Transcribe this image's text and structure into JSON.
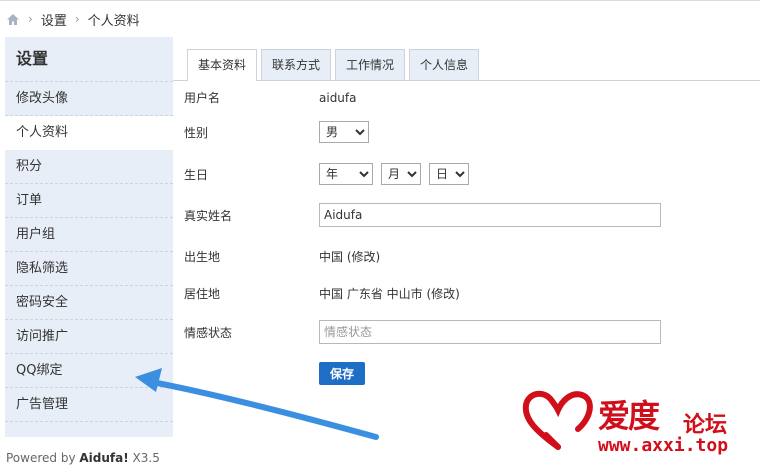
{
  "breadcrumb": {
    "home_icon": "home-icon",
    "sep": "›",
    "items": [
      "设置",
      "个人资料"
    ]
  },
  "sidebar": {
    "title": "设置",
    "items": [
      {
        "label": "修改头像"
      },
      {
        "label": "个人资料",
        "active": true
      },
      {
        "label": "积分"
      },
      {
        "label": "订单"
      },
      {
        "label": "用户组"
      },
      {
        "label": "隐私筛选"
      },
      {
        "label": "密码安全"
      },
      {
        "label": "访问推广"
      },
      {
        "label": "QQ绑定"
      },
      {
        "label": "广告管理"
      }
    ]
  },
  "tabs": [
    "基本资料",
    "联系方式",
    "工作情况",
    "个人信息"
  ],
  "form": {
    "username_label": "用户名",
    "username_value": "aidufa",
    "gender_label": "性别",
    "gender_value": "男",
    "birthday_label": "生日",
    "year_value": "年",
    "month_value": "月",
    "day_value": "日",
    "realname_label": "真实姓名",
    "realname_value": "Aidufa",
    "birthplace_label": "出生地",
    "birthplace_value": "中国 (修改)",
    "residence_label": "居住地",
    "residence_value": "中国 广东省 中山市 (修改)",
    "relationship_label": "情感状态",
    "relationship_placeholder": "情感状态",
    "save_label": "保存"
  },
  "footer": {
    "prefix": "Powered by ",
    "brand": "Aidufa!",
    "version": " X3.5"
  },
  "watermark": {
    "name": "爱度",
    "suffix": "论坛",
    "url": "www.axxi.top"
  },
  "colors": {
    "accent": "#1e6ec6",
    "sidebar_bg": "#e8eef7",
    "arrow": "#3a8fe0",
    "watermark": "#d10f1b"
  }
}
